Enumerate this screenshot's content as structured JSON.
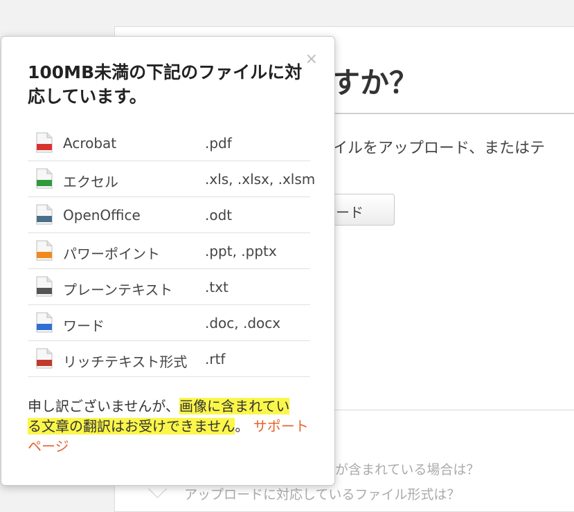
{
  "background": {
    "title": "すか？",
    "description": "ァイルをアップロード、またはテ",
    "upload_button_label": "ード",
    "faq_item_1": "が含まれている場合は？",
    "faq_item_2": "アップロードに対応しているファイル形式は？"
  },
  "popover": {
    "title": "100MB未満の下記のファイルに対応しています。",
    "close_label": "×",
    "files": [
      {
        "name": "Acrobat",
        "ext": ".pdf",
        "icon": "pdf-file-icon",
        "badge": "PDF",
        "color": "#d9322c"
      },
      {
        "name": "エクセル",
        "ext": ".xls, .xlsx, .xlsm",
        "icon": "xls-file-icon",
        "badge": "XLS",
        "color": "#2e9a3c"
      },
      {
        "name": "OpenOffice",
        "ext": ".odt",
        "icon": "odt-file-icon",
        "badge": "ODT",
        "color": "#4a6f8a"
      },
      {
        "name": "パワーポイント",
        "ext": ".ppt, .pptx",
        "icon": "ppt-file-icon",
        "badge": "PPT",
        "color": "#f08a1c"
      },
      {
        "name": "プレーンテキスト",
        "ext": ".txt",
        "icon": "txt-file-icon",
        "badge": "TXT",
        "color": "#555555"
      },
      {
        "name": "ワード",
        "ext": ".doc, .docx",
        "icon": "doc-file-icon",
        "badge": "DOC",
        "color": "#2e6fd4"
      },
      {
        "name": "リッチテキスト形式",
        "ext": ".rtf",
        "icon": "rtf-file-icon",
        "badge": "RTF",
        "color": "#c0392b"
      }
    ],
    "note_part1": "申し訳ございませんが、",
    "note_highlight_1": "画像に含まれてい",
    "note_highlight_2": "る文章の翻訳はお受けできません",
    "note_part2": "。 ",
    "support_link": "サポートページ",
    "highlight_color": "#fbf64a",
    "link_color": "#e8612c"
  }
}
